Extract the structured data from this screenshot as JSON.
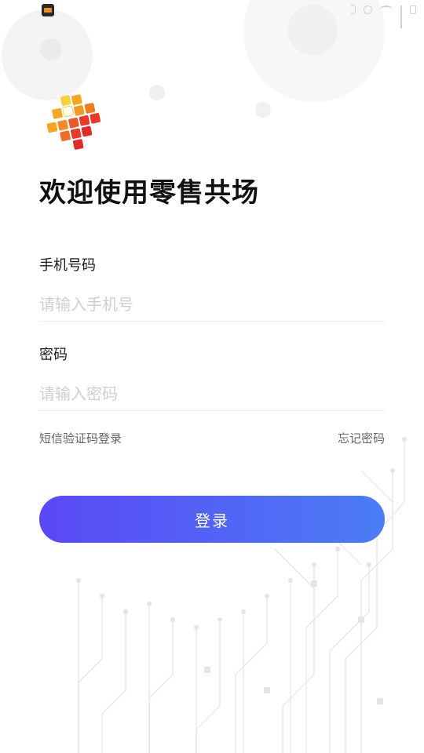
{
  "status_bar": {
    "icons": [
      "app-icon",
      "bluetooth-icon",
      "alarm-icon",
      "wifi-icon",
      "signal-icon",
      "battery-icon"
    ]
  },
  "brand": {
    "logo": "retail-logo-icon",
    "colors": {
      "orange": "#f5a623",
      "red": "#e8382b",
      "yellow": "#f8d13a"
    }
  },
  "welcome_title": "欢迎使用零售共场",
  "form": {
    "phone_label": "手机号码",
    "phone_placeholder": "请输入手机号",
    "password_label": "密码",
    "password_placeholder": "请输入密码"
  },
  "links": {
    "sms_login": "短信验证码登录",
    "forgot_password": "忘记密码"
  },
  "login_button": {
    "label": "登录",
    "gradient": [
      "#5a48f5",
      "#4a7df5"
    ]
  }
}
